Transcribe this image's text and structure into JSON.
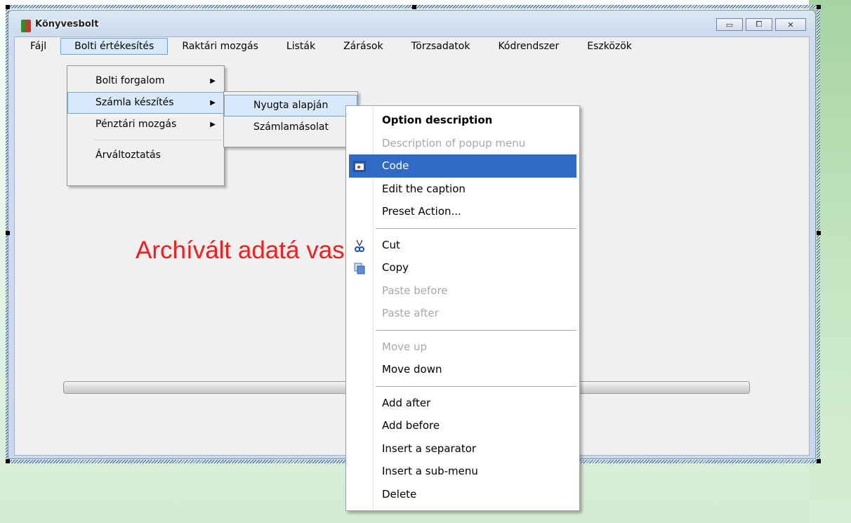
{
  "window": {
    "title": "Könyvesbolt",
    "buttons": {
      "minimize": "▭",
      "maximize": "⧠",
      "close": "✕"
    }
  },
  "menubar": [
    "Fájl",
    "Bolti értékesítés",
    "Raktári mozgás",
    "Listák",
    "Zárások",
    "Törzsadatok",
    "Kódrendszer",
    "Eszközök"
  ],
  "submenu1": {
    "items": [
      "Bolti forgalom",
      "Számla készítés",
      "Pénztári mozgás",
      "Árváltoztatás"
    ],
    "arrow": "▶"
  },
  "submenu2": {
    "items": [
      "Nyugta alapján",
      "Számlamásolat"
    ]
  },
  "main": {
    "message": "Archívált adatá                              vasható!"
  },
  "context_menu": {
    "header": "Option description",
    "description": "Description of popup menu",
    "code": "Code",
    "edit_caption": "Edit the caption",
    "preset": "Preset Action...",
    "cut": "Cut",
    "copy": "Copy",
    "paste_before": "Paste before",
    "paste_after": "Paste after",
    "move_up": "Move up",
    "move_down": "Move down",
    "add_after": "Add after",
    "add_before": "Add before",
    "insert_sep": "Insert a separator",
    "insert_sub": "Insert a sub-menu",
    "delete": "Delete"
  },
  "colors": {
    "accent": "#3169c6",
    "message": "#ff1a1a",
    "hover": "#d7e9fb"
  }
}
